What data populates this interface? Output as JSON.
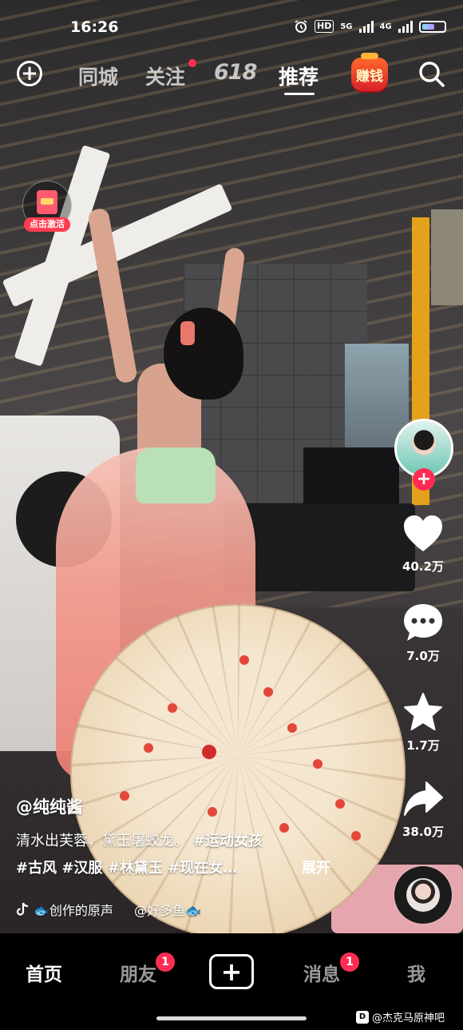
{
  "status_bar": {
    "time": "16:26",
    "hd": "HD",
    "net1": "5G",
    "net2": "4G"
  },
  "top_nav": {
    "items": [
      "同城",
      "关注",
      "618",
      "推荐"
    ],
    "active": "推荐",
    "earn_label": "赚钱"
  },
  "activation": {
    "label": "点击激活"
  },
  "video": {
    "author": "@纯纯酱",
    "desc_line1_text": "清水出芙蓉，黛玉屠蛟龙。",
    "desc_line1_tag": "#运动女孩",
    "desc_line2": "#古风 #汉服 #林黛玉 #现在女…",
    "expand": "展开",
    "music_text": "🐟创作的原声",
    "music_credit": "@好多鱼🐟"
  },
  "actions": {
    "likes": "40.2万",
    "comments": "7.0万",
    "favorites": "1.7万",
    "shares": "38.0万"
  },
  "bottom_nav": {
    "home": "首页",
    "friends": "朋友",
    "friends_badge": "1",
    "messages": "消息",
    "messages_badge": "1",
    "me": "我"
  },
  "watermark": {
    "logo": "D",
    "text": "@杰克马原神吧"
  },
  "colors": {
    "accent_red": "#fe2c55",
    "background": "#000000"
  }
}
